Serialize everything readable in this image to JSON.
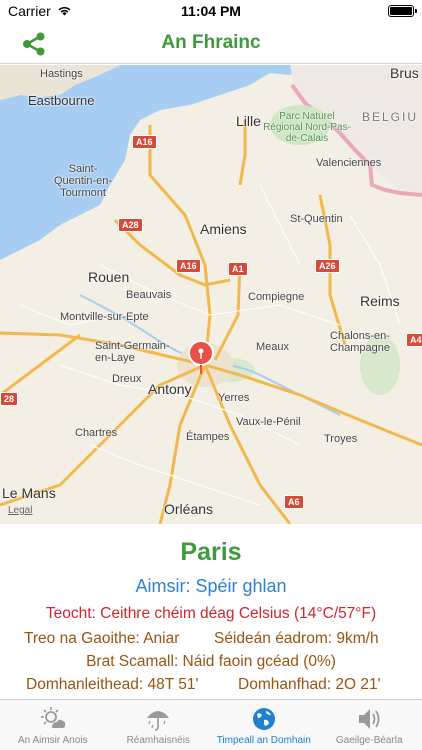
{
  "status_bar": {
    "carrier": "Carrier",
    "time": "11:04 PM",
    "battery_level": 1.0
  },
  "nav": {
    "title": "An Fhrainc",
    "share_icon": "share-icon"
  },
  "map": {
    "labels": {
      "hastings": "Hastings",
      "eastbourne": "Eastbourne",
      "lille": "Lille",
      "brussels": "Brus",
      "belgium": "BELGIU",
      "park": "Parc Naturel Régional Nord-Pas-de-Calais",
      "valenciennes": "Valenciennes",
      "saint_quentin_tourmont": "Saint-Quentin-en-Tourmont",
      "amiens": "Amiens",
      "st_quentin": "St-Quentin",
      "rouen": "Rouen",
      "beauvais": "Beauvais",
      "compiegne": "Compiegne",
      "reims": "Reims",
      "montivilliers": "Montville-sur-Epte",
      "saint_germain": "Saint-Germain-en-Laye",
      "meaux": "Meaux",
      "chalons": "Chalons-en-Champagne",
      "dreux": "Dreux",
      "antony": "Antony",
      "yerres": "Yerres",
      "vaux": "Vaux-le-Pénil",
      "chartres": "Chartres",
      "etampes": "Étampes",
      "troyes": "Troyes",
      "le_mans": "Le Mans",
      "orleans": "Orléans",
      "legal": "Legal"
    },
    "shields": {
      "a16_top": "A16",
      "a28": "A28",
      "a16_mid": "A16",
      "a1": "A1",
      "a26": "A26",
      "a4": "A4",
      "a28_left": "28",
      "a6": "A6"
    },
    "pin_icon": "map-pin-icon"
  },
  "info": {
    "city": "Paris",
    "weather": "Aimsir: Spéir ghlan",
    "temperature": "Teocht: Ceithre chéim déag Celsius (14°C/57°F)",
    "wind_direction": "Treo na Gaoithe: Aniar",
    "wind_speed": "Séideán éadrom: 9km/h",
    "cloud_cover": "Brat Scamall: Náid faoin gcéad (0%)",
    "latitude": "Domhanleithead: 48T 51'",
    "longitude": "Domhanfhad: 2O 21'"
  },
  "tabs": [
    {
      "label": "An Aimsir Anois",
      "icon": "weather-now-icon",
      "active": false
    },
    {
      "label": "Réamhaisnéis",
      "icon": "umbrella-icon",
      "active": false
    },
    {
      "label": "Timpeall an Domhain",
      "icon": "globe-icon",
      "active": true
    },
    {
      "label": "Gaeilge-Béarla",
      "icon": "speaker-icon",
      "active": false
    }
  ],
  "colors": {
    "title_green": "#3f9a3c",
    "weather_blue": "#2f7fd6",
    "temp_red": "#d0262e",
    "detail_brown": "#9a5412",
    "tab_active": "#1f7fd1",
    "pin_red": "#e8504a"
  }
}
